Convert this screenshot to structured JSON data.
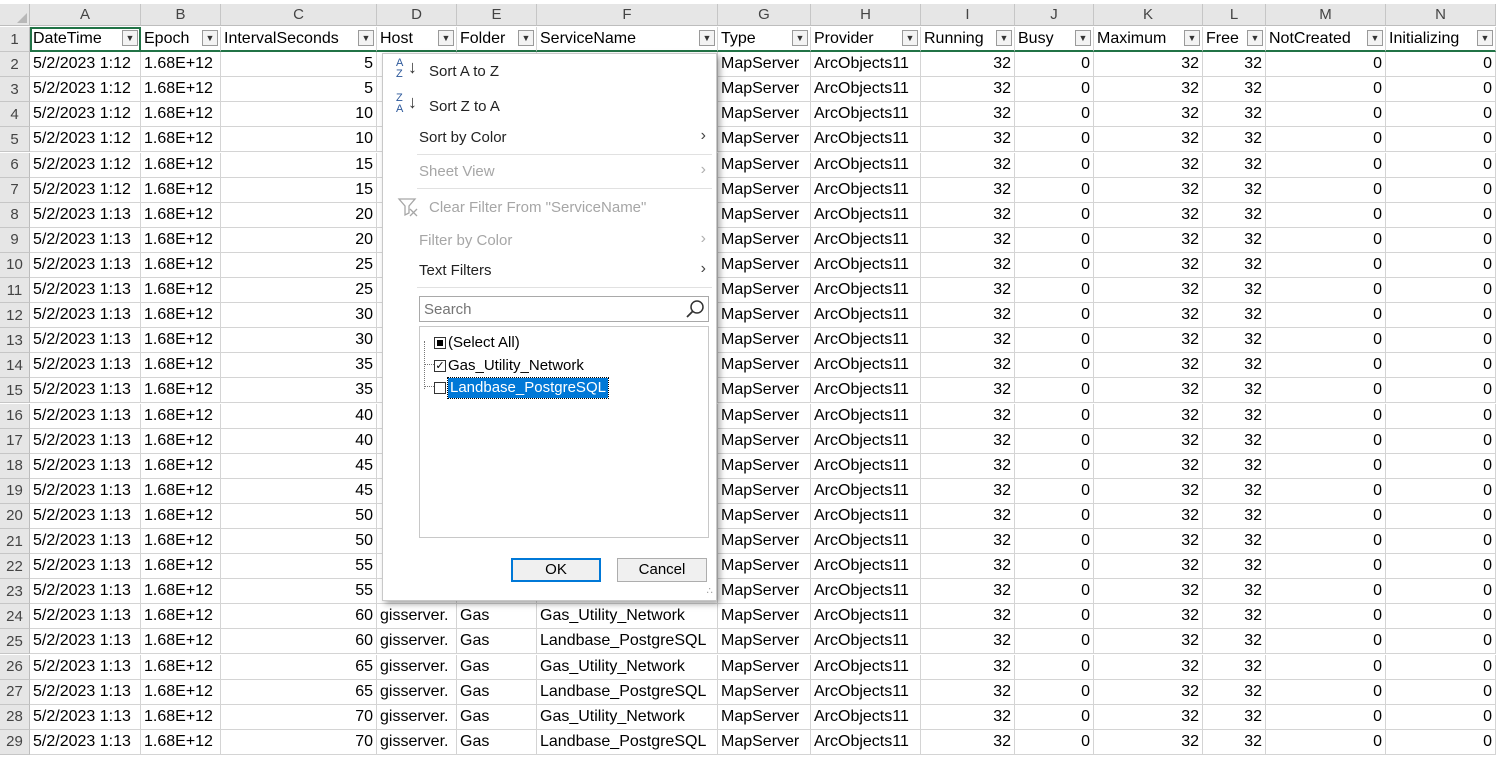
{
  "columns": [
    {
      "letter": "A",
      "header": "DateTime"
    },
    {
      "letter": "B",
      "header": "Epoch"
    },
    {
      "letter": "C",
      "header": "IntervalSeconds"
    },
    {
      "letter": "D",
      "header": "Host"
    },
    {
      "letter": "E",
      "header": "Folder"
    },
    {
      "letter": "F",
      "header": "ServiceName"
    },
    {
      "letter": "G",
      "header": "Type"
    },
    {
      "letter": "H",
      "header": "Provider"
    },
    {
      "letter": "I",
      "header": "Running"
    },
    {
      "letter": "J",
      "header": "Busy"
    },
    {
      "letter": "K",
      "header": "Maximum"
    },
    {
      "letter": "L",
      "header": "Free"
    },
    {
      "letter": "M",
      "header": "NotCreated"
    },
    {
      "letter": "N",
      "header": "Initializing"
    }
  ],
  "rows": [
    {
      "n": "2",
      "A": "5/2/2023 1:12",
      "B": "1.68E+12",
      "C": "5",
      "D": "",
      "E": "",
      "F": "",
      "G": "MapServer",
      "H": "ArcObjects11",
      "I": "32",
      "J": "0",
      "K": "32",
      "L": "32",
      "M": "0",
      "N": "0"
    },
    {
      "n": "3",
      "A": "5/2/2023 1:12",
      "B": "1.68E+12",
      "C": "5",
      "D": "",
      "E": "",
      "F": "",
      "G": "MapServer",
      "H": "ArcObjects11",
      "I": "32",
      "J": "0",
      "K": "32",
      "L": "32",
      "M": "0",
      "N": "0"
    },
    {
      "n": "4",
      "A": "5/2/2023 1:12",
      "B": "1.68E+12",
      "C": "10",
      "D": "",
      "E": "",
      "F": "",
      "G": "MapServer",
      "H": "ArcObjects11",
      "I": "32",
      "J": "0",
      "K": "32",
      "L": "32",
      "M": "0",
      "N": "0"
    },
    {
      "n": "5",
      "A": "5/2/2023 1:12",
      "B": "1.68E+12",
      "C": "10",
      "D": "",
      "E": "",
      "F": "",
      "G": "MapServer",
      "H": "ArcObjects11",
      "I": "32",
      "J": "0",
      "K": "32",
      "L": "32",
      "M": "0",
      "N": "0"
    },
    {
      "n": "6",
      "A": "5/2/2023 1:12",
      "B": "1.68E+12",
      "C": "15",
      "D": "",
      "E": "",
      "F": "",
      "G": "MapServer",
      "H": "ArcObjects11",
      "I": "32",
      "J": "0",
      "K": "32",
      "L": "32",
      "M": "0",
      "N": "0"
    },
    {
      "n": "7",
      "A": "5/2/2023 1:12",
      "B": "1.68E+12",
      "C": "15",
      "D": "",
      "E": "",
      "F": "",
      "G": "MapServer",
      "H": "ArcObjects11",
      "I": "32",
      "J": "0",
      "K": "32",
      "L": "32",
      "M": "0",
      "N": "0"
    },
    {
      "n": "8",
      "A": "5/2/2023 1:13",
      "B": "1.68E+12",
      "C": "20",
      "D": "",
      "E": "",
      "F": "",
      "G": "MapServer",
      "H": "ArcObjects11",
      "I": "32",
      "J": "0",
      "K": "32",
      "L": "32",
      "M": "0",
      "N": "0"
    },
    {
      "n": "9",
      "A": "5/2/2023 1:13",
      "B": "1.68E+12",
      "C": "20",
      "D": "",
      "E": "",
      "F": "",
      "G": "MapServer",
      "H": "ArcObjects11",
      "I": "32",
      "J": "0",
      "K": "32",
      "L": "32",
      "M": "0",
      "N": "0"
    },
    {
      "n": "10",
      "A": "5/2/2023 1:13",
      "B": "1.68E+12",
      "C": "25",
      "D": "",
      "E": "",
      "F": "",
      "G": "MapServer",
      "H": "ArcObjects11",
      "I": "32",
      "J": "0",
      "K": "32",
      "L": "32",
      "M": "0",
      "N": "0"
    },
    {
      "n": "11",
      "A": "5/2/2023 1:13",
      "B": "1.68E+12",
      "C": "25",
      "D": "",
      "E": "",
      "F": "",
      "G": "MapServer",
      "H": "ArcObjects11",
      "I": "32",
      "J": "0",
      "K": "32",
      "L": "32",
      "M": "0",
      "N": "0"
    },
    {
      "n": "12",
      "A": "5/2/2023 1:13",
      "B": "1.68E+12",
      "C": "30",
      "D": "",
      "E": "",
      "F": "",
      "G": "MapServer",
      "H": "ArcObjects11",
      "I": "32",
      "J": "0",
      "K": "32",
      "L": "32",
      "M": "0",
      "N": "0"
    },
    {
      "n": "13",
      "A": "5/2/2023 1:13",
      "B": "1.68E+12",
      "C": "30",
      "D": "",
      "E": "",
      "F": "",
      "G": "MapServer",
      "H": "ArcObjects11",
      "I": "32",
      "J": "0",
      "K": "32",
      "L": "32",
      "M": "0",
      "N": "0"
    },
    {
      "n": "14",
      "A": "5/2/2023 1:13",
      "B": "1.68E+12",
      "C": "35",
      "D": "",
      "E": "",
      "F": "",
      "G": "MapServer",
      "H": "ArcObjects11",
      "I": "32",
      "J": "0",
      "K": "32",
      "L": "32",
      "M": "0",
      "N": "0"
    },
    {
      "n": "15",
      "A": "5/2/2023 1:13",
      "B": "1.68E+12",
      "C": "35",
      "D": "",
      "E": "",
      "F": "",
      "G": "MapServer",
      "H": "ArcObjects11",
      "I": "32",
      "J": "0",
      "K": "32",
      "L": "32",
      "M": "0",
      "N": "0"
    },
    {
      "n": "16",
      "A": "5/2/2023 1:13",
      "B": "1.68E+12",
      "C": "40",
      "D": "",
      "E": "",
      "F": "",
      "G": "MapServer",
      "H": "ArcObjects11",
      "I": "32",
      "J": "0",
      "K": "32",
      "L": "32",
      "M": "0",
      "N": "0"
    },
    {
      "n": "17",
      "A": "5/2/2023 1:13",
      "B": "1.68E+12",
      "C": "40",
      "D": "",
      "E": "",
      "F": "",
      "G": "MapServer",
      "H": "ArcObjects11",
      "I": "32",
      "J": "0",
      "K": "32",
      "L": "32",
      "M": "0",
      "N": "0"
    },
    {
      "n": "18",
      "A": "5/2/2023 1:13",
      "B": "1.68E+12",
      "C": "45",
      "D": "",
      "E": "",
      "F": "",
      "G": "MapServer",
      "H": "ArcObjects11",
      "I": "32",
      "J": "0",
      "K": "32",
      "L": "32",
      "M": "0",
      "N": "0"
    },
    {
      "n": "19",
      "A": "5/2/2023 1:13",
      "B": "1.68E+12",
      "C": "45",
      "D": "",
      "E": "",
      "F": "",
      "G": "MapServer",
      "H": "ArcObjects11",
      "I": "32",
      "J": "0",
      "K": "32",
      "L": "32",
      "M": "0",
      "N": "0"
    },
    {
      "n": "20",
      "A": "5/2/2023 1:13",
      "B": "1.68E+12",
      "C": "50",
      "D": "",
      "E": "",
      "F": "",
      "G": "MapServer",
      "H": "ArcObjects11",
      "I": "32",
      "J": "0",
      "K": "32",
      "L": "32",
      "M": "0",
      "N": "0"
    },
    {
      "n": "21",
      "A": "5/2/2023 1:13",
      "B": "1.68E+12",
      "C": "50",
      "D": "",
      "E": "",
      "F": "",
      "G": "MapServer",
      "H": "ArcObjects11",
      "I": "32",
      "J": "0",
      "K": "32",
      "L": "32",
      "M": "0",
      "N": "0"
    },
    {
      "n": "22",
      "A": "5/2/2023 1:13",
      "B": "1.68E+12",
      "C": "55",
      "D": "",
      "E": "",
      "F": "",
      "G": "MapServer",
      "H": "ArcObjects11",
      "I": "32",
      "J": "0",
      "K": "32",
      "L": "32",
      "M": "0",
      "N": "0"
    },
    {
      "n": "23",
      "A": "5/2/2023 1:13",
      "B": "1.68E+12",
      "C": "55",
      "D": "",
      "E": "",
      "F": "",
      "G": "MapServer",
      "H": "ArcObjects11",
      "I": "32",
      "J": "0",
      "K": "32",
      "L": "32",
      "M": "0",
      "N": "0"
    },
    {
      "n": "24",
      "A": "5/2/2023 1:13",
      "B": "1.68E+12",
      "C": "60",
      "D": "gisserver.",
      "E": "Gas",
      "F": "Gas_Utility_Network",
      "G": "MapServer",
      "H": "ArcObjects11",
      "I": "32",
      "J": "0",
      "K": "32",
      "L": "32",
      "M": "0",
      "N": "0"
    },
    {
      "n": "25",
      "A": "5/2/2023 1:13",
      "B": "1.68E+12",
      "C": "60",
      "D": "gisserver.",
      "E": "Gas",
      "F": "Landbase_PostgreSQL",
      "G": "MapServer",
      "H": "ArcObjects11",
      "I": "32",
      "J": "0",
      "K": "32",
      "L": "32",
      "M": "0",
      "N": "0"
    },
    {
      "n": "26",
      "A": "5/2/2023 1:13",
      "B": "1.68E+12",
      "C": "65",
      "D": "gisserver.",
      "E": "Gas",
      "F": "Gas_Utility_Network",
      "G": "MapServer",
      "H": "ArcObjects11",
      "I": "32",
      "J": "0",
      "K": "32",
      "L": "32",
      "M": "0",
      "N": "0"
    },
    {
      "n": "27",
      "A": "5/2/2023 1:13",
      "B": "1.68E+12",
      "C": "65",
      "D": "gisserver.",
      "E": "Gas",
      "F": "Landbase_PostgreSQL",
      "G": "MapServer",
      "H": "ArcObjects11",
      "I": "32",
      "J": "0",
      "K": "32",
      "L": "32",
      "M": "0",
      "N": "0"
    },
    {
      "n": "28",
      "A": "5/2/2023 1:13",
      "B": "1.68E+12",
      "C": "70",
      "D": "gisserver.",
      "E": "Gas",
      "F": "Gas_Utility_Network",
      "G": "MapServer",
      "H": "ArcObjects11",
      "I": "32",
      "J": "0",
      "K": "32",
      "L": "32",
      "M": "0",
      "N": "0"
    },
    {
      "n": "29",
      "A": "5/2/2023 1:13",
      "B": "1.68E+12",
      "C": "70",
      "D": "gisserver.",
      "E": "Gas",
      "F": "Landbase_PostgreSQL",
      "G": "MapServer",
      "H": "ArcObjects11",
      "I": "32",
      "J": "0",
      "K": "32",
      "L": "32",
      "M": "0",
      "N": "0"
    }
  ],
  "header_row_number": "1",
  "filter_menu": {
    "sort_az": "Sort A to Z",
    "sort_za": "Sort Z to A",
    "sort_by_color": "Sort by Color",
    "sheet_view": "Sheet View",
    "clear_filter": "Clear Filter From \"ServiceName\"",
    "filter_by_color": "Filter by Color",
    "text_filters": "Text Filters",
    "search_placeholder": "Search",
    "items": [
      {
        "label": "(Select All)",
        "state": "mixed"
      },
      {
        "label": "Gas_Utility_Network",
        "state": "checked"
      },
      {
        "label": "Landbase_PostgreSQL",
        "state": "unchecked",
        "highlighted": true
      }
    ],
    "ok_label": "OK",
    "cancel_label": "Cancel"
  },
  "colors": {
    "selection": "#0078d7",
    "header_green": "#217346",
    "sort_icon": "#2b579a"
  }
}
